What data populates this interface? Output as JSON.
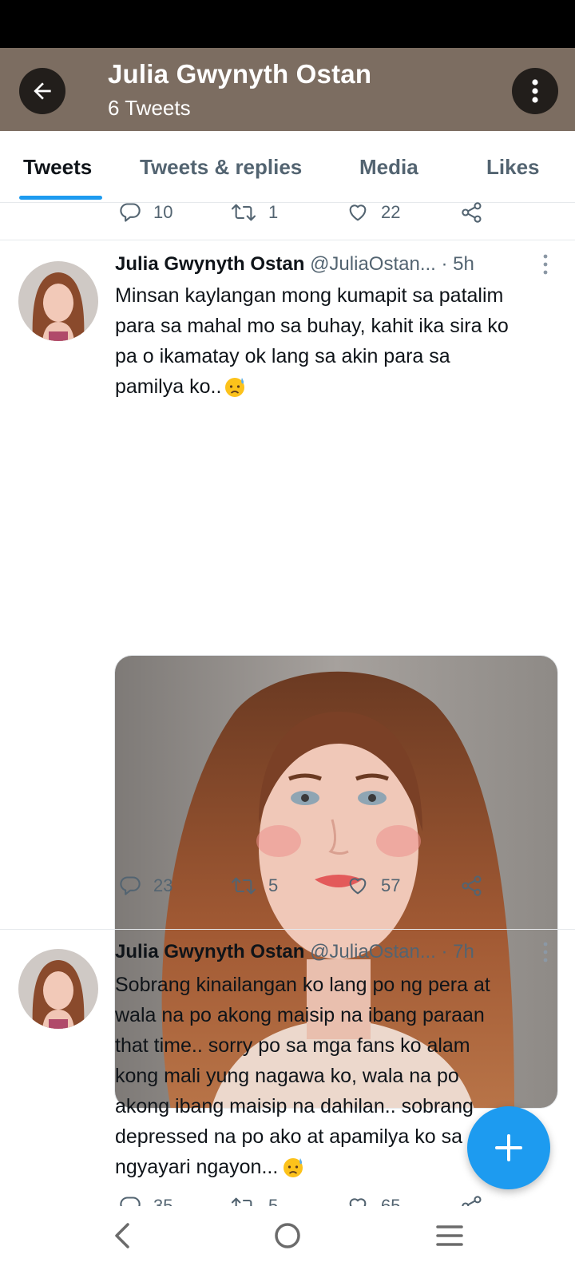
{
  "header": {
    "title": "Julia Gwynyth Ostan",
    "subtitle": "6 Tweets"
  },
  "tabs": [
    {
      "label": "Tweets",
      "active": true
    },
    {
      "label": "Tweets & replies",
      "active": false
    },
    {
      "label": "Media",
      "active": false
    },
    {
      "label": "Likes",
      "active": false
    }
  ],
  "previous_tweet": {
    "replies": "10",
    "retweets": "1",
    "likes": "22"
  },
  "tweets": [
    {
      "name": "Julia Gwynyth Ostan",
      "handle": "@JuliaOstan...",
      "time": "· 5h",
      "lines": [
        "Minsan kaylangan mong kumapit sa patalim",
        "para sa mahal mo sa buhay, kahit ika sira ko",
        "pa o ikamatay ok lang sa akin para sa",
        "pamilya ko.."
      ],
      "replies": "23",
      "retweets": "5",
      "likes": "57",
      "emoji": "sad-sweat-face-icon"
    },
    {
      "name": "Julia Gwynyth Ostan",
      "handle": "@JuliaOstan...",
      "time": "· 7h",
      "lines": [
        "Sobrang kinailangan ko lang po ng pera at",
        "wala na po akong maisip na ibang paraan",
        "that time.. sorry po sa mga fans ko alam",
        "kong mali yung nagawa ko, wala na po",
        "akong ibang maisip na dahilan.. sobrang",
        "depressed na po ako at apamilya ko sa",
        "ngyayari ngayon..."
      ],
      "replies": "35",
      "retweets": "5",
      "likes": "65",
      "emoji": "sad-sweat-face-icon"
    }
  ],
  "colors": {
    "header_bg": "#7c6d61",
    "accent": "#1d9bf0",
    "text": "#0f1419",
    "muted": "#536471"
  }
}
